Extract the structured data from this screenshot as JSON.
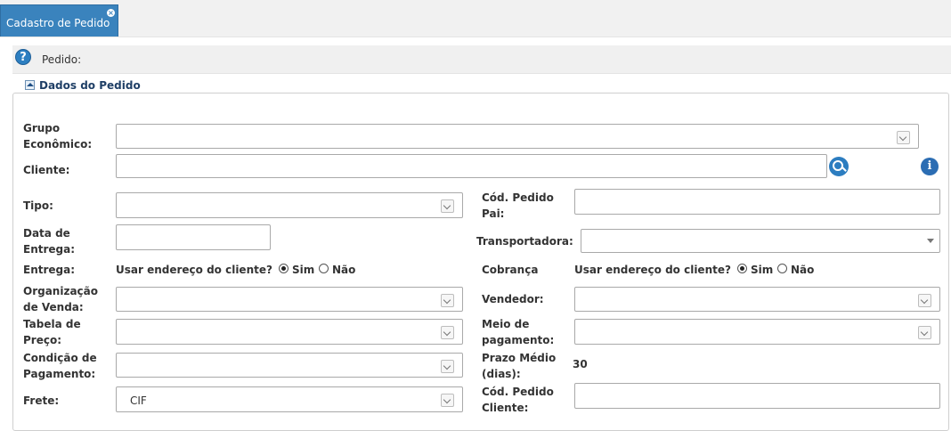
{
  "tab": {
    "label": "Cadastro de Pedido",
    "close": "×"
  },
  "header": {
    "help": "?",
    "label": "Pedido:"
  },
  "section": {
    "title": "Dados do Pedido"
  },
  "labels": {
    "grupo1": "Grupo",
    "grupo2": "Econômico:",
    "cliente": "Cliente:",
    "tipo": "Tipo:",
    "cod_pai1": "Cód. Pedido",
    "cod_pai2": "Pai:",
    "data1": "Data de",
    "data2": "Entrega:",
    "transportadora": "Transportadora:",
    "entrega": "Entrega:",
    "cobranca": "Cobrança",
    "org1": "Organização",
    "org2": "de Venda:",
    "vendedor": "Vendedor:",
    "tabela1": "Tabela de",
    "tabela2": "Preço:",
    "meio1": "Meio de",
    "meio2": "pagamento:",
    "cond1": "Condição de",
    "cond2": "Pagamento:",
    "prazo1": "Prazo Médio",
    "prazo2": "(dias):",
    "frete": "Frete:",
    "cod_cli1": "Cód. Pedido",
    "cod_cli2": "Cliente:"
  },
  "entrega": {
    "question": "Usar endereço do cliente?",
    "sim": "Sim",
    "nao": "Não"
  },
  "cobranca": {
    "question": "Usar endereço do cliente?",
    "sim": "Sim",
    "nao": "Não"
  },
  "values": {
    "prazo": "30",
    "frete": "CIF"
  },
  "icons": {
    "info": "i"
  }
}
